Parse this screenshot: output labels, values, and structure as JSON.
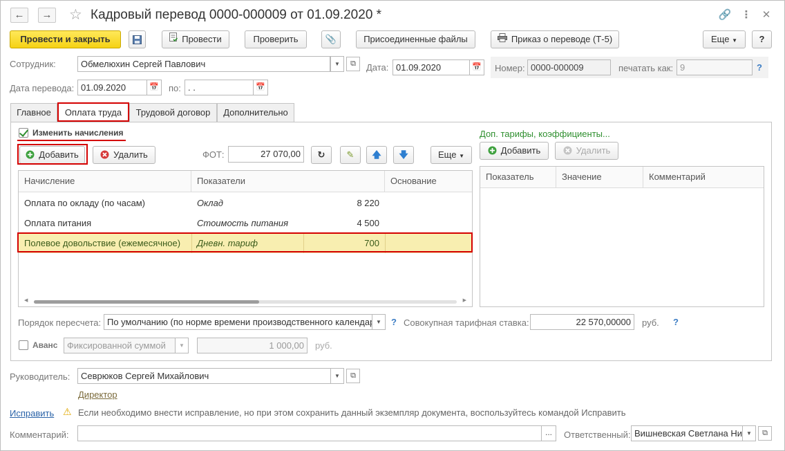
{
  "title": "Кадровый перевод 0000-000009 от 01.09.2020 *",
  "icons": {
    "back": "arrow-left-icon",
    "forward": "arrow-right-icon",
    "favorite": "star-icon",
    "link": "link-icon",
    "menu": "more-vert-icon",
    "close": "close-icon"
  },
  "toolbar": {
    "post_close": "Провести и закрыть",
    "post": "Провести",
    "check": "Проверить",
    "attached_files": "Присоединенные файлы",
    "print_order": "Приказ о переводе (Т-5)",
    "more": "Еще",
    "help": "?"
  },
  "header": {
    "employee_label": "Сотрудник:",
    "employee_value": "Обмелюхин Сергей Павлович",
    "date_label": "Дата:",
    "date_value": "01.09.2020",
    "number_label": "Номер:",
    "number_value": "0000-000009",
    "print_as_label": "печатать как:",
    "print_as_value": "9",
    "transfer_date_label": "Дата перевода:",
    "transfer_date_value": "01.09.2020",
    "to_label": "по:",
    "to_value": ".  ."
  },
  "tabs": [
    "Главное",
    "Оплата труда",
    "Трудовой договор",
    "Дополнительно"
  ],
  "active_tab": 1,
  "payment": {
    "change_accruals_label": "Изменить начисления",
    "change_accruals_checked": true,
    "add": "Добавить",
    "delete": "Удалить",
    "fot_label": "ФОТ:",
    "fot_value": "27 070,00",
    "more": "Еще",
    "columns": [
      "Начисление",
      "Показатели",
      "Основание"
    ],
    "rows": [
      {
        "accrual": "Оплата по окладу (по часам)",
        "indicator": "Оклад",
        "value": "8 220"
      },
      {
        "accrual": "Оплата питания",
        "indicator": "Стоимость питания",
        "value": "4 500"
      },
      {
        "accrual": "Полевое довольствие (ежемесячное)",
        "indicator": "Дневн. тариф",
        "value": "700"
      }
    ],
    "selected_row": 2,
    "scroll_position": 0.52
  },
  "tariffs": {
    "title": "Доп. тарифы, коэффициенты...",
    "add": "Добавить",
    "delete": "Удалить",
    "columns": [
      "Показатель",
      "Значение",
      "Комментарий"
    ]
  },
  "recalc": {
    "label": "Порядок пересчета:",
    "value": "По умолчанию (по норме времени производственного календар",
    "total_rate_label": "Совокупная тарифная ставка:",
    "total_rate_value": "22 570,00000",
    "currency": "руб."
  },
  "advance": {
    "label": "Аванс",
    "checked": false,
    "mode": "Фиксированной суммой",
    "amount": "1 000,00",
    "currency": "руб."
  },
  "footer": {
    "manager_label": "Руководитель:",
    "manager_value": "Севрюков Сергей Михайлович",
    "manager_position": "Директор",
    "fix_link": "Исправить",
    "fix_hint": "Если необходимо внести исправление, но при этом сохранить данный экземпляр документа, воспользуйтесь командой Исправить",
    "comment_label": "Комментарий:",
    "comment_value": "",
    "comment_button": "...",
    "responsible_label": "Ответственный:",
    "responsible_value": "Вишневская Светлана Ни"
  },
  "colors": {
    "accent": "#f5d214",
    "highlight": "#d40000",
    "selection": "#f8eeb0",
    "link": "#2a63a8",
    "green": "#2f8f2f"
  }
}
